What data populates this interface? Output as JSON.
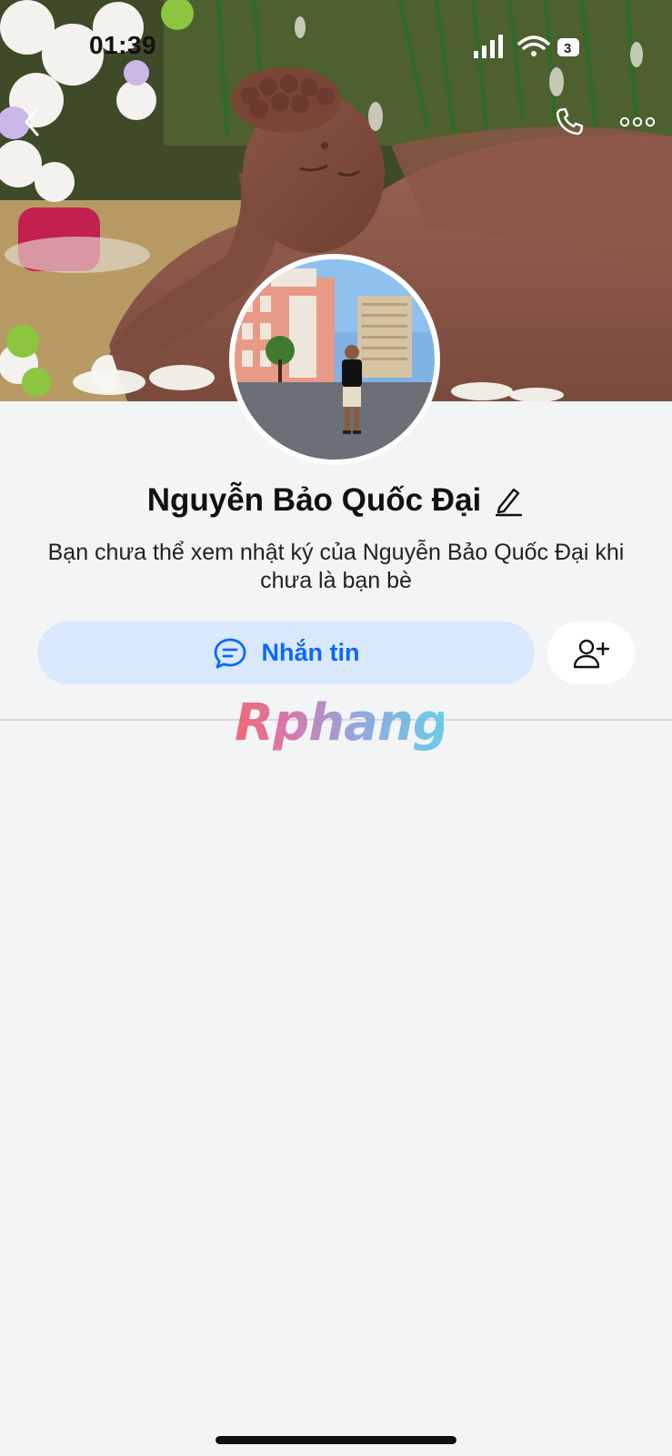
{
  "status_bar": {
    "time": "01:39",
    "icons": [
      "signal-icon",
      "wifi-icon",
      "battery-icon"
    ]
  },
  "nav": {
    "back_icon": "chevron-left-icon",
    "call_icon": "phone-icon",
    "more_icon": "more-dots-icon"
  },
  "profile": {
    "name": "Nguyễn Bảo Quốc Đại",
    "edit_icon": "pencil-icon",
    "privacy_hint": "Bạn chưa thể xem nhật ký của Nguyễn Bảo Quốc Đại khi chưa là bạn bè"
  },
  "actions": {
    "message_label": "Nhắn tin",
    "message_icon": "chat-bubble-icon",
    "add_friend_icon": "add-friend-icon"
  },
  "watermark": "Rphang",
  "colors": {
    "accent": "#0a68ff",
    "message_button_bg": "#d9e8fc",
    "page_bg": "#f3f4f6"
  }
}
